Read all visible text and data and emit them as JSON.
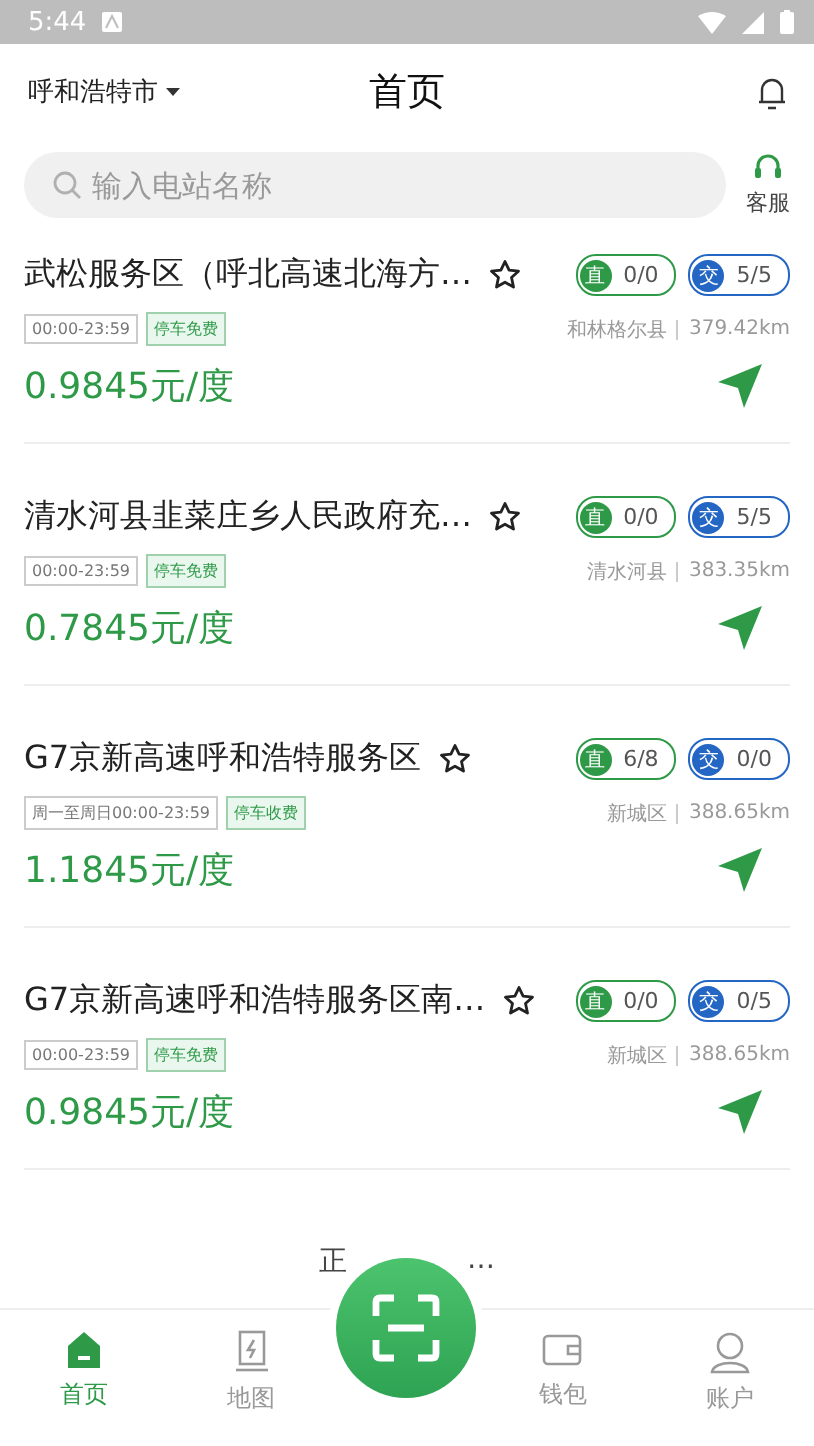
{
  "status_bar": {
    "time": "5:44"
  },
  "header": {
    "city": "呼和浩特市",
    "title": "首页"
  },
  "search": {
    "placeholder": "输入电站名称"
  },
  "service": {
    "label": "客服"
  },
  "stations": [
    {
      "name": "武松服务区（呼北高速北海方…",
      "favorite": false,
      "chargers": [
        {
          "kind": "dc",
          "badge": "直",
          "count": "0/0"
        },
        {
          "kind": "ac",
          "badge": "交",
          "count": "5/5"
        }
      ],
      "hours": "00:00-23:59",
      "parking": "停车免费",
      "district": "和林格尔县",
      "distance": "379.42km",
      "price": "0.9845元/度"
    },
    {
      "name": "清水河县韭菜庄乡人民政府充…",
      "favorite": false,
      "chargers": [
        {
          "kind": "dc",
          "badge": "直",
          "count": "0/0"
        },
        {
          "kind": "ac",
          "badge": "交",
          "count": "5/5"
        }
      ],
      "hours": "00:00-23:59",
      "parking": "停车免费",
      "district": "清水河县",
      "distance": "383.35km",
      "price": "0.7845元/度"
    },
    {
      "name": "G7京新高速呼和浩特服务区",
      "favorite": false,
      "chargers": [
        {
          "kind": "dc",
          "badge": "直",
          "count": "6/8"
        },
        {
          "kind": "ac",
          "badge": "交",
          "count": "0/0"
        }
      ],
      "hours": "周一至周日00:00-23:59",
      "parking": "停车收费",
      "district": "新城区",
      "distance": "388.65km",
      "price": "1.1845元/度"
    },
    {
      "name": "G7京新高速呼和浩特服务区南…",
      "favorite": false,
      "chargers": [
        {
          "kind": "dc",
          "badge": "直",
          "count": "0/0"
        },
        {
          "kind": "ac",
          "badge": "交",
          "count": "0/5"
        }
      ],
      "hours": "00:00-23:59",
      "parking": "停车免费",
      "district": "新城区",
      "distance": "388.65km",
      "price": "0.9845元/度"
    }
  ],
  "loading": {
    "left_part": "正",
    "right_part": "…"
  },
  "nav": [
    {
      "kind": "home",
      "label": "首页",
      "selected": true
    },
    {
      "kind": "map",
      "label": "地图",
      "selected": false
    },
    {
      "kind": "scan",
      "selected": false
    },
    {
      "kind": "wallet",
      "label": "钱包",
      "selected": false
    },
    {
      "kind": "account",
      "label": "账户",
      "selected": false
    }
  ]
}
